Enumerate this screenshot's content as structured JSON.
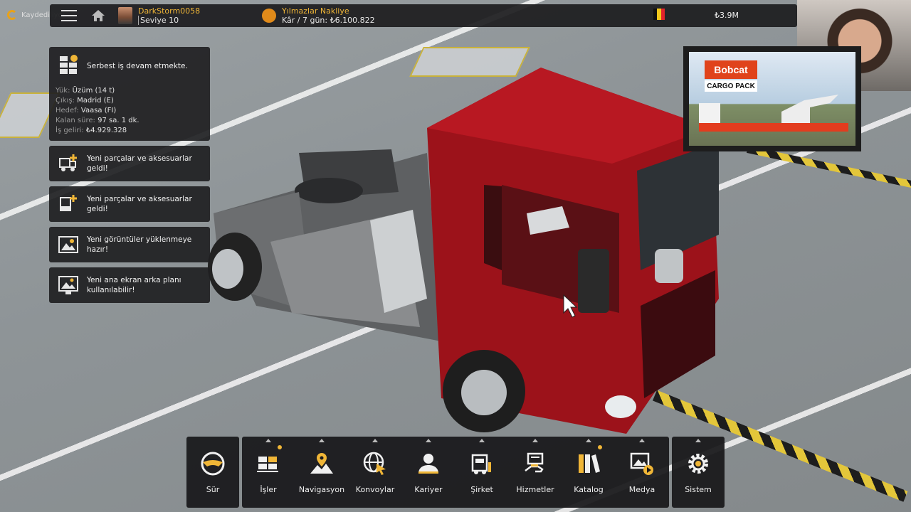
{
  "topbar": {
    "saving_text": "Kaydediliyor",
    "user_name": "DarkStorm0058",
    "user_level": "Seviye 10",
    "company_name": "Yılmazlar Nakliye",
    "company_profit": "Kâr / 7 gün: ₺6.100.822",
    "money": "₺3.9M"
  },
  "ad": {
    "brand": "Bobcat",
    "subtitle": "CARGO PACK"
  },
  "job": {
    "title": "Serbest iş devam etmekte.",
    "cargo_label": "Yük:",
    "cargo_value": "Üzüm (14 t)",
    "origin_label": "Çıkış:",
    "origin_value": "Madrid (E)",
    "dest_label": "Hedef:",
    "dest_value": "Vaasa (FI)",
    "remaining_label": "Kalan süre:",
    "remaining_value": "97 sa. 1 dk.",
    "income_label": "İş geliri:",
    "income_value": "₺4.929.328"
  },
  "notifications": [
    {
      "line1": "Yeni parçalar ve aksesuarlar",
      "line2": "geldi!"
    },
    {
      "line1": "Yeni parçalar ve aksesuarlar",
      "line2": "geldi!"
    },
    {
      "line1": "Yeni görüntüler yüklenmeye",
      "line2": "hazır!"
    },
    {
      "line1": "Yeni ana ekran arka planı",
      "line2": "kullanılabilir!"
    }
  ],
  "nav": {
    "drive": "Sür",
    "jobs": "İşler",
    "navigation": "Navigasyon",
    "convoys": "Konvoylar",
    "career": "Kariyer",
    "company": "Şirket",
    "services": "Hizmetler",
    "catalog": "Katalog",
    "media": "Medya",
    "system": "Sistem"
  },
  "colors": {
    "accent": "#f0b637",
    "panel": "#202022",
    "truck": "#a2141c"
  }
}
